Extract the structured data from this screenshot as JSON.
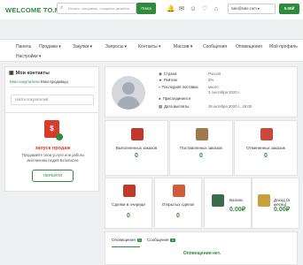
{
  "header": {
    "logo": "WELCOME TO.ME",
    "search_placeholder": "Искать, например, создание дизайна",
    "search_button": "Поиск",
    "email": "sale@sale.com",
    "balance": "0.00₽"
  },
  "nav": {
    "items": [
      "Панель",
      "Продажи ▾",
      "Закупки ▾",
      "Запросы ▾",
      "Контакты ▾",
      "Массив ▾",
      "Сообщения",
      "Оповещения",
      "Мой профиль",
      "Настройки ▾"
    ]
  },
  "contacts": {
    "title": "Мои контакты",
    "tabs": [
      "Мои покупатели",
      "Мои продавцы"
    ],
    "search_placeholder": "Найти покупателей"
  },
  "promo": {
    "title": "запуск продаж",
    "text": "Продавайте свои услуги или работы миллионам людей Безопасно.",
    "button": "ПЕРЕЙТИ"
  },
  "profile": {
    "rows": [
      {
        "label": "Страна",
        "value": "Россия"
      },
      {
        "label": "Рейтинг",
        "value": "0%"
      },
      {
        "label": "Последняя поставка",
        "value": "много\n3 сентября 2020 г."
      },
      {
        "label": "Присоединился",
        "value": ""
      },
      {
        "label": "Дата выплаты",
        "value": "26 октября 2020 г., 19:00"
      }
    ]
  },
  "stats_top": [
    {
      "label": "Выполненных заказов",
      "value": "0"
    },
    {
      "label": "Поставленных заказов",
      "value": "0"
    },
    {
      "label": "Отмененных заказов",
      "value": "0"
    }
  ],
  "stats_bottom": [
    {
      "label": "Сделки в очереди",
      "value": "0"
    },
    {
      "label": "Открытых сделок",
      "value": "0"
    },
    {
      "label": "Баланс",
      "value": "0.00₽"
    },
    {
      "label": "Доход (в месяц)",
      "value": "0.00₽"
    }
  ],
  "notifications": {
    "tab1": "Оповещения",
    "tab1_count": "0",
    "tab2": "Сообщения",
    "tab2_count": "0",
    "empty": "Оповещения нет."
  }
}
